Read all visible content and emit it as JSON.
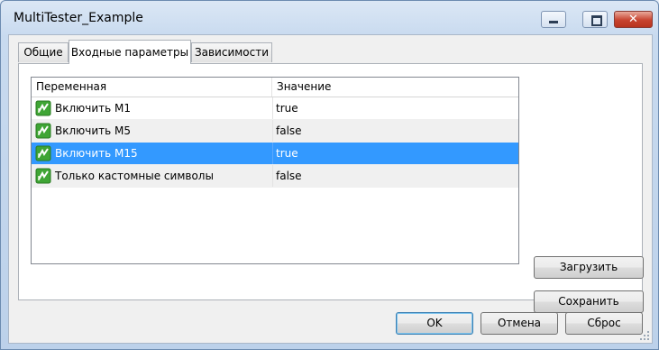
{
  "window": {
    "title": "MultiTester_Example",
    "minimize": "",
    "maximize": "",
    "close": "✕"
  },
  "tabs": [
    {
      "label": "Общие"
    },
    {
      "label": "Входные параметры",
      "active": true
    },
    {
      "label": "Зависимости"
    }
  ],
  "table": {
    "columns": [
      "Переменная",
      "Значение"
    ],
    "rows": [
      {
        "name": "Включить M1",
        "value": "true"
      },
      {
        "name": "Включить M5",
        "value": "false"
      },
      {
        "name": "Включить M15",
        "value": "true",
        "selected": true
      },
      {
        "name": "Только кастомные символы",
        "value": "false"
      }
    ],
    "row_icon": "parameter-icon"
  },
  "side_buttons": {
    "load": "Загрузить",
    "save": "Сохранить"
  },
  "dialog_buttons": {
    "ok": "OK",
    "cancel": "Отмена",
    "reset": "Сброс"
  },
  "colors": {
    "selection": "#3399ff",
    "alt_row": "#f0f0f0",
    "icon_green": "#3fa535"
  }
}
